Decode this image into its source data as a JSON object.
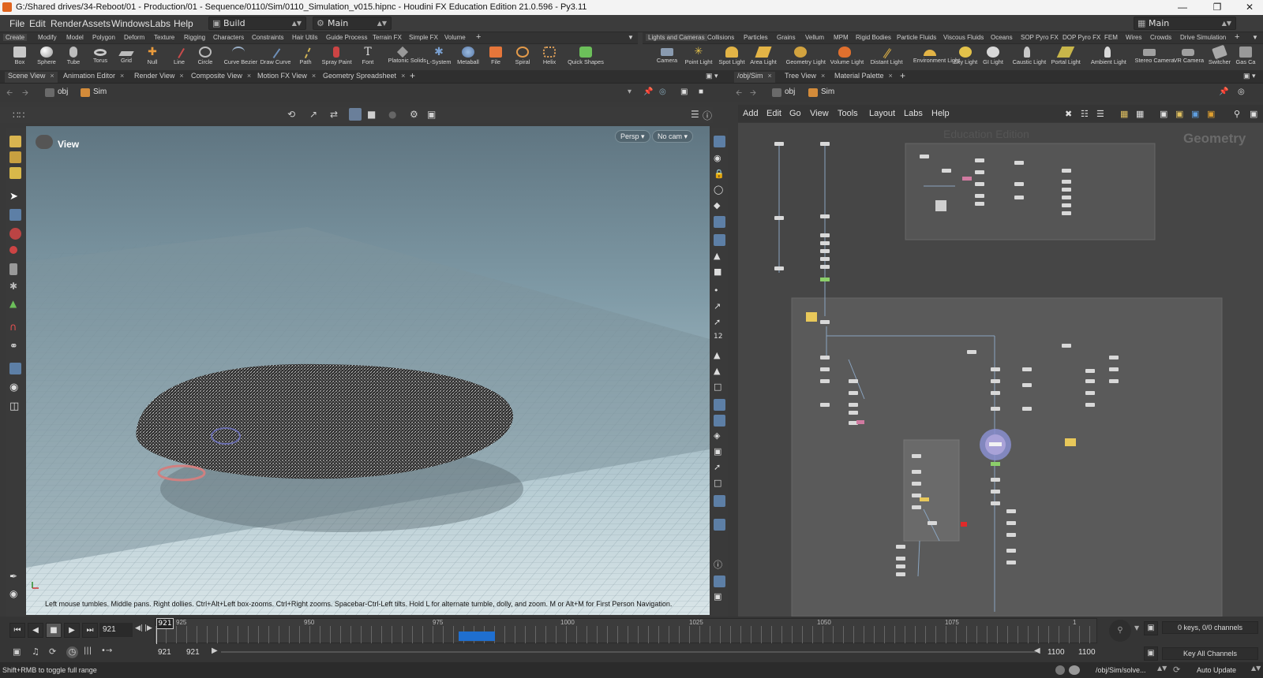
{
  "window": {
    "title": "G:/Shared drives/34-Reboot/01 - Production/01 - Sequence/0110/Sim/0110_Simulation_v015.hipnc - Houdini FX Education Edition 21.0.596 - Py3.11"
  },
  "menubar": {
    "items": [
      "File",
      "Edit",
      "Render",
      "Assets",
      "Windows",
      "Labs",
      "Help"
    ],
    "desktop_left": "Build",
    "desktop_mid": "Main",
    "desktop_right": "Main"
  },
  "shelf_left": {
    "tabs": [
      "Create",
      "Modify",
      "Model",
      "Polygon",
      "Deform",
      "Texture",
      "Rigging",
      "Characters",
      "Constraints",
      "Hair Utils",
      "Guide Process",
      "Terrain FX",
      "Simple FX",
      "Volume"
    ],
    "tools": [
      "Box",
      "Sphere",
      "Tube",
      "Torus",
      "Grid",
      "Null",
      "Line",
      "Circle",
      "Curve Bezier",
      "Draw Curve",
      "Path",
      "Spray Paint",
      "Font",
      "Platonic Solids",
      "L-System",
      "Metaball",
      "File",
      "Spiral",
      "Helix",
      "Quick Shapes"
    ]
  },
  "shelf_right": {
    "tabs": [
      "Lights and Cameras",
      "Collisions",
      "Particles",
      "Grains",
      "Vellum",
      "MPM",
      "Rigid Bodies",
      "Particle Fluids",
      "Viscous Fluids",
      "Oceans",
      "SOP Pyro FX",
      "DOP Pyro FX",
      "FEM",
      "Wires",
      "Crowds",
      "Drive Simulation"
    ],
    "tools": [
      "Camera",
      "Point Light",
      "Spot Light",
      "Area Light",
      "Geometry Light",
      "Volume Light",
      "Distant Light",
      "Environment Light",
      "Sky Light",
      "GI Light",
      "Caustic Light",
      "Portal Light",
      "Ambient Light",
      "Stereo Camera",
      "VR Camera",
      "Switcher",
      "Gas Ca"
    ]
  },
  "left_pane": {
    "tabs": [
      "Scene View",
      "Animation Editor",
      "Render View",
      "Composite View",
      "Motion FX View",
      "Geometry Spreadsheet"
    ],
    "path": [
      "obj",
      "Sim"
    ],
    "viewport": {
      "label": "View",
      "persp": "Persp ▾",
      "cam": "No cam ▾",
      "hint": "Left mouse tumbles. Middle pans. Right dollies. Ctrl+Alt+Left box-zooms. Ctrl+Right zooms. Spacebar-Ctrl-Left tilts. Hold L for alternate tumble, dolly, and zoom. M or Alt+M for First Person Navigation."
    }
  },
  "right_pane": {
    "tabs": [
      "/obj/Sim",
      "Tree View",
      "Material Palette"
    ],
    "path": [
      "obj",
      "Sim"
    ],
    "menu": [
      "Add",
      "Edit",
      "Go",
      "View",
      "Tools",
      "Layout",
      "Labs",
      "Help"
    ],
    "watermark": "Education Edition",
    "context_label": "Geometry"
  },
  "timeline": {
    "current_frame": "921",
    "frame_marker": "921",
    "ticks": [
      "925",
      "950",
      "975",
      "1000",
      "1025",
      "1050",
      "1075",
      "1"
    ],
    "range_start": "921",
    "range_start2": "921",
    "range_end": "1100",
    "range_end2": "1100",
    "keys_info": "0 keys, 0/0 channels",
    "key_all": "Key All Channels"
  },
  "status": {
    "left": "Shift+RMB to toggle full range",
    "path": "/obj/Sim/solve...",
    "update": "Auto Update"
  }
}
